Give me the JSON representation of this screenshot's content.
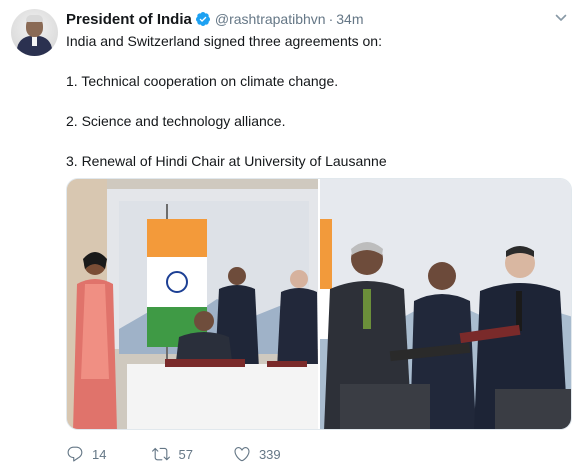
{
  "tweet": {
    "author_name": "President of India",
    "handle": "@rashtrapatibhvn",
    "separator": "·",
    "time": "34m",
    "lines": [
      "India and Switzerland signed three agreements on:",
      "",
      "1. Technical cooperation on climate change.",
      "",
      "2. Science and technology alliance.",
      "",
      "3. Renewal of Hindi Chair at University of Lausanne"
    ],
    "icons": {
      "verified": "verified-badge-icon",
      "caret": "chevron-down-icon",
      "reply": "reply-icon",
      "retweet": "retweet-icon",
      "like": "heart-icon"
    },
    "colors": {
      "verified": "#1da1f2",
      "secondary_text": "#657786",
      "primary_text": "#14171a"
    }
  },
  "actions": {
    "reply_count": "14",
    "retweet_count": "57",
    "like_count": "339"
  }
}
